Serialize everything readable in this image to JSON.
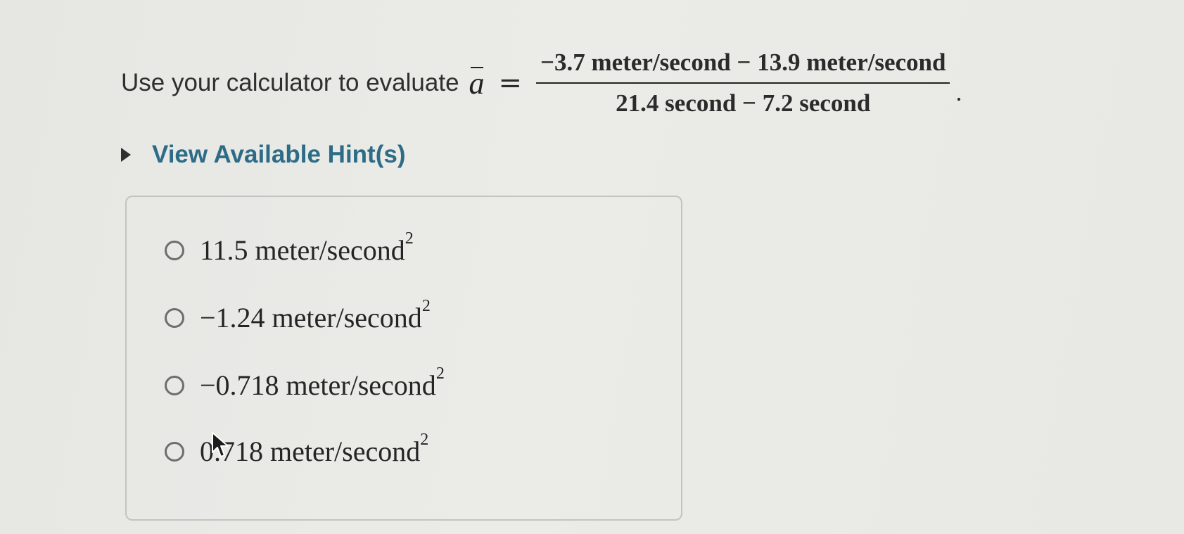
{
  "question": {
    "prompt": "Use your calculator to evaluate",
    "variable": "a",
    "equals": "=",
    "numerator": "−3.7 meter/second − 13.9 meter/second",
    "denominator": "21.4 second − 7.2 second",
    "period": "."
  },
  "hint": {
    "label": "View Available Hint(s)",
    "icon": "caret-right-icon"
  },
  "options": [
    {
      "value": "11.5 meter/second",
      "exponent": "2"
    },
    {
      "value": "−1.24 meter/second",
      "exponent": "2"
    },
    {
      "value": "−0.718 meter/second",
      "exponent": "2"
    },
    {
      "value": "0.718 meter/second",
      "exponent": "2"
    }
  ],
  "colors": {
    "hint_text": "#2d6c87",
    "background": "#e9e9e5",
    "border": "#c3c3c0"
  }
}
